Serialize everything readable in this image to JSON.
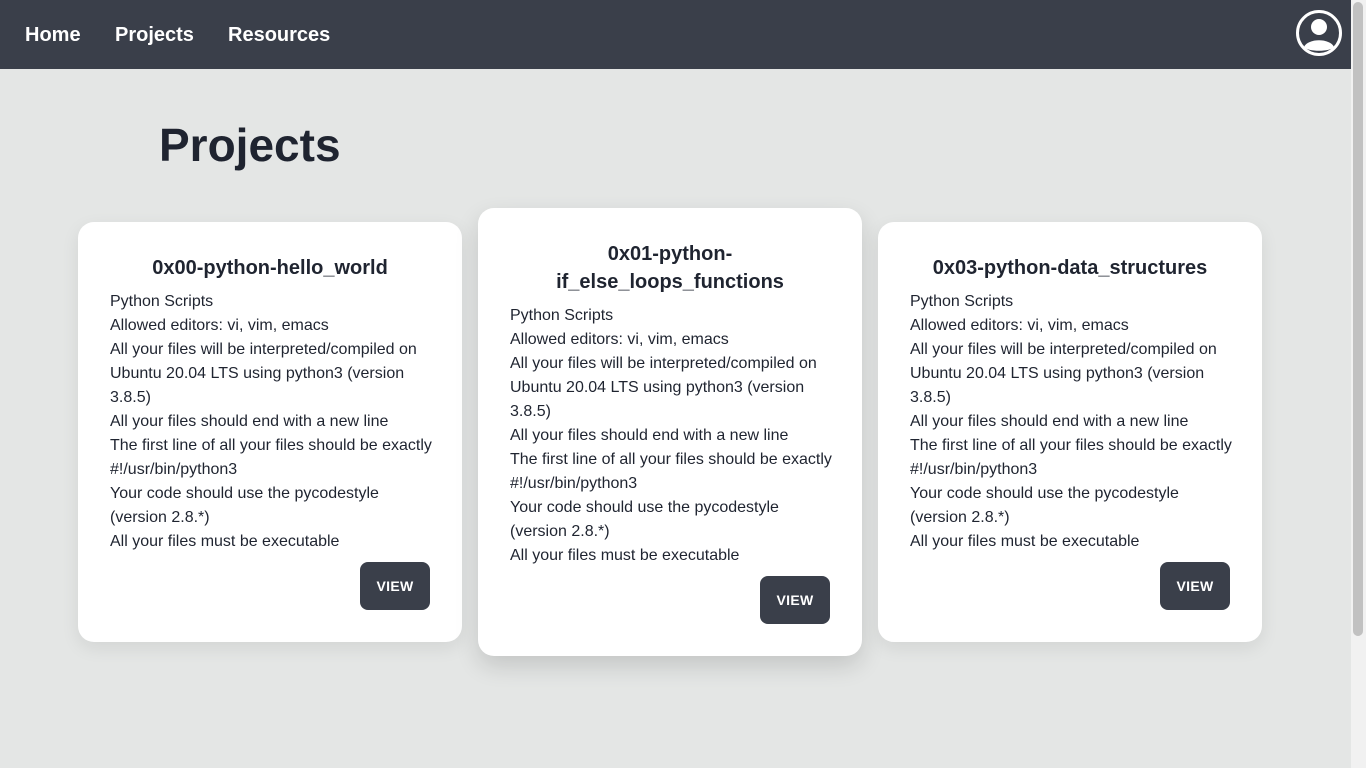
{
  "nav": {
    "items": [
      {
        "label": "Home"
      },
      {
        "label": "Projects"
      },
      {
        "label": "Resources"
      }
    ],
    "avatar_icon": "user-circle-icon"
  },
  "main": {
    "title": "Projects",
    "cards": [
      {
        "title": "0x00-python-hello_world",
        "lines": [
          "Python Scripts",
          "Allowed editors: vi, vim, emacs",
          "All your files will be interpreted/compiled on Ubuntu 20.04 LTS using python3 (version 3.8.5)",
          "All your files should end with a new line",
          "The first line of all your files should be exactly #!/usr/bin/python3",
          "Your code should use the pycodestyle (version 2.8.*)",
          "All your files must be executable"
        ],
        "button_label": "VIEW"
      },
      {
        "title": "0x01-python-if_else_loops_functions",
        "title_line1": "0x01-python-",
        "title_line2": "if_else_loops_functions",
        "lines": [
          "Python Scripts",
          "Allowed editors: vi, vim, emacs",
          "All your files will be interpreted/compiled on Ubuntu 20.04 LTS using python3 (version 3.8.5)",
          "All your files should end with a new line",
          "The first line of all your files should be exactly #!/usr/bin/python3",
          "Your code should use the pycodestyle (version 2.8.*)",
          "All your files must be executable"
        ],
        "button_label": "VIEW"
      },
      {
        "title": "0x03-python-data_structures",
        "lines": [
          "Python Scripts",
          "Allowed editors: vi, vim, emacs",
          "All your files will be interpreted/compiled on Ubuntu 20.04 LTS using python3 (version 3.8.5)",
          "All your files should end with a new line",
          "The first line of all your files should be exactly #!/usr/bin/python3",
          "Your code should use the pycodestyle (version 2.8.*)",
          "All your files must be executable"
        ],
        "button_label": "VIEW"
      }
    ]
  },
  "colors": {
    "navbar": "#3a3f4a",
    "background": "#e4e6e5",
    "card": "#ffffff",
    "button": "#3a3f4a",
    "text": "#1f2430"
  }
}
